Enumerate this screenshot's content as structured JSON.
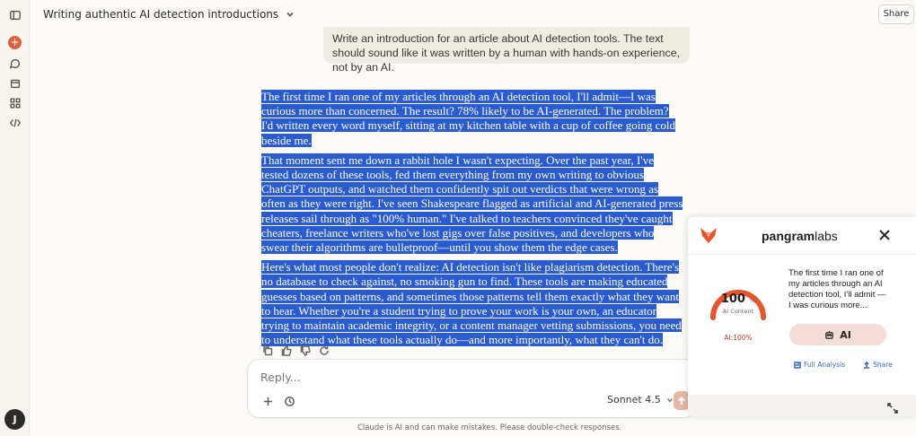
{
  "header": {
    "conversation_title": "Writing authentic AI detection introductions",
    "share_label": "Share"
  },
  "sidebar": {
    "avatar_initial": "J",
    "icons": [
      "sidebar-toggle-icon",
      "new-chat-icon",
      "chats-icon",
      "projects-icon",
      "artifacts-icon",
      "code-icon"
    ]
  },
  "prompt": {
    "text": "Write an introduction for an article about AI detection tools. The text should sound like it was written by a human with hands-on experience, not by an AI."
  },
  "response": {
    "paragraphs": [
      "The first time I ran one of my articles through an AI detection tool, I'll admit—I was curious more than concerned. The result? 78% likely to be AI-generated. The problem? I'd written every word myself, sitting at my kitchen table with a cup of coffee going cold beside me.",
      "That moment sent me down a rabbit hole I wasn't expecting. Over the past year, I've tested dozens of these tools, fed them everything from my own writing to obvious ChatGPT outputs, and watched them confidently spit out verdicts that were wrong as often as they were right. I've seen Shakespeare flagged as artificial and AI-generated press releases sail through as \"100% human.\" I've talked to teachers convinced they've caught cheaters, freelance writers who've lost gigs over false positives, and developers who swear their algorithms are bulletproof—until you show them the edge cases.",
      "Here's what most people don't realize: AI detection isn't like plagiarism detection. There's no database to check against, no smoking gun to find. These tools are making educated guesses based on patterns, and sometimes those patterns tell them exactly what they want to hear. Whether you're a student trying to prove your work is your own, an educator trying to maintain academic integrity, or a content manager vetting submissions, you need to understand what these tools actually do—and more importantly, what they can't do."
    ]
  },
  "reply": {
    "placeholder": "Reply...",
    "model": "Sonnet 4.5",
    "disclaimer": "Claude is AI and can make mistakes. Please double-check responses."
  },
  "pangram": {
    "brand_bold": "pangram",
    "brand_rest": "labs",
    "score": 100,
    "score_unit": "%",
    "score_label": "AI Content",
    "ai_percent_label": "AI:100%",
    "excerpt": "The first time I ran one of my articles through an AI detection tool, I'll admit —I was curious more...",
    "verdict": "AI",
    "full_analysis": "Full Analysis",
    "share": "Share",
    "gauge_color": "#e8542c"
  }
}
